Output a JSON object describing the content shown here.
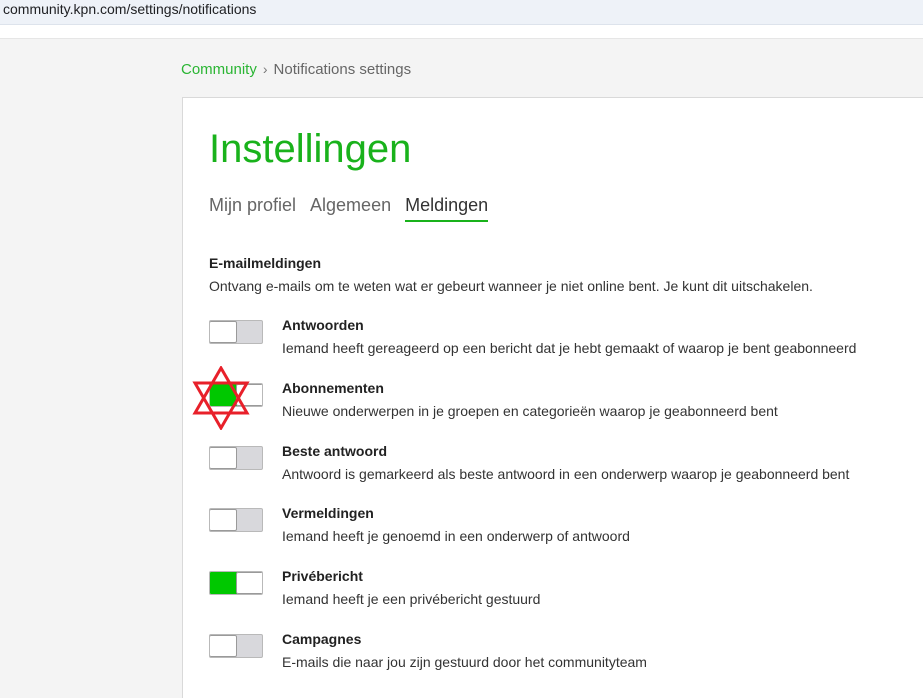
{
  "browser": {
    "url": "community.kpn.com/settings/notifications"
  },
  "breadcrumb": {
    "root": "Community",
    "separator": "›",
    "current": "Notifications settings"
  },
  "page": {
    "title": "Instellingen"
  },
  "tabs": [
    {
      "label": "Mijn profiel",
      "active": false
    },
    {
      "label": "Algemeen",
      "active": false
    },
    {
      "label": "Meldingen",
      "active": true
    }
  ],
  "email_section": {
    "title": "E-mailmeldingen",
    "description": "Ontvang e-mails om te weten wat er gebeurt wanneer je niet online bent. Je kunt dit uitschakelen."
  },
  "settings": [
    {
      "title": "Antwoorden",
      "description": "Iemand heeft gereageerd op een bericht dat je hebt gemaakt of waarop je bent geabonneerd",
      "enabled": false
    },
    {
      "title": "Abonnementen",
      "description": "Nieuwe onderwerpen in je groepen en categorieën waarop je geabonneerd bent",
      "enabled": true
    },
    {
      "title": "Beste antwoord",
      "description": "Antwoord is gemarkeerd als beste antwoord in een onderwerp waarop je geabonneerd bent",
      "enabled": false
    },
    {
      "title": "Vermeldingen",
      "description": "Iemand heeft je genoemd in een onderwerp of antwoord",
      "enabled": false
    },
    {
      "title": "Privébericht",
      "description": "Iemand heeft je een privébericht gestuurd",
      "enabled": true
    },
    {
      "title": "Campagnes",
      "description": "E-mails die naar jou zijn gestuurd door het communityteam",
      "enabled": false
    }
  ],
  "colors": {
    "brand_green": "#19b21b",
    "toggle_on": "#00c800",
    "toggle_off": "#d8d8dc",
    "annotation_red": "#e8202a"
  },
  "icons": {
    "annotation": "star-of-david-outline"
  }
}
